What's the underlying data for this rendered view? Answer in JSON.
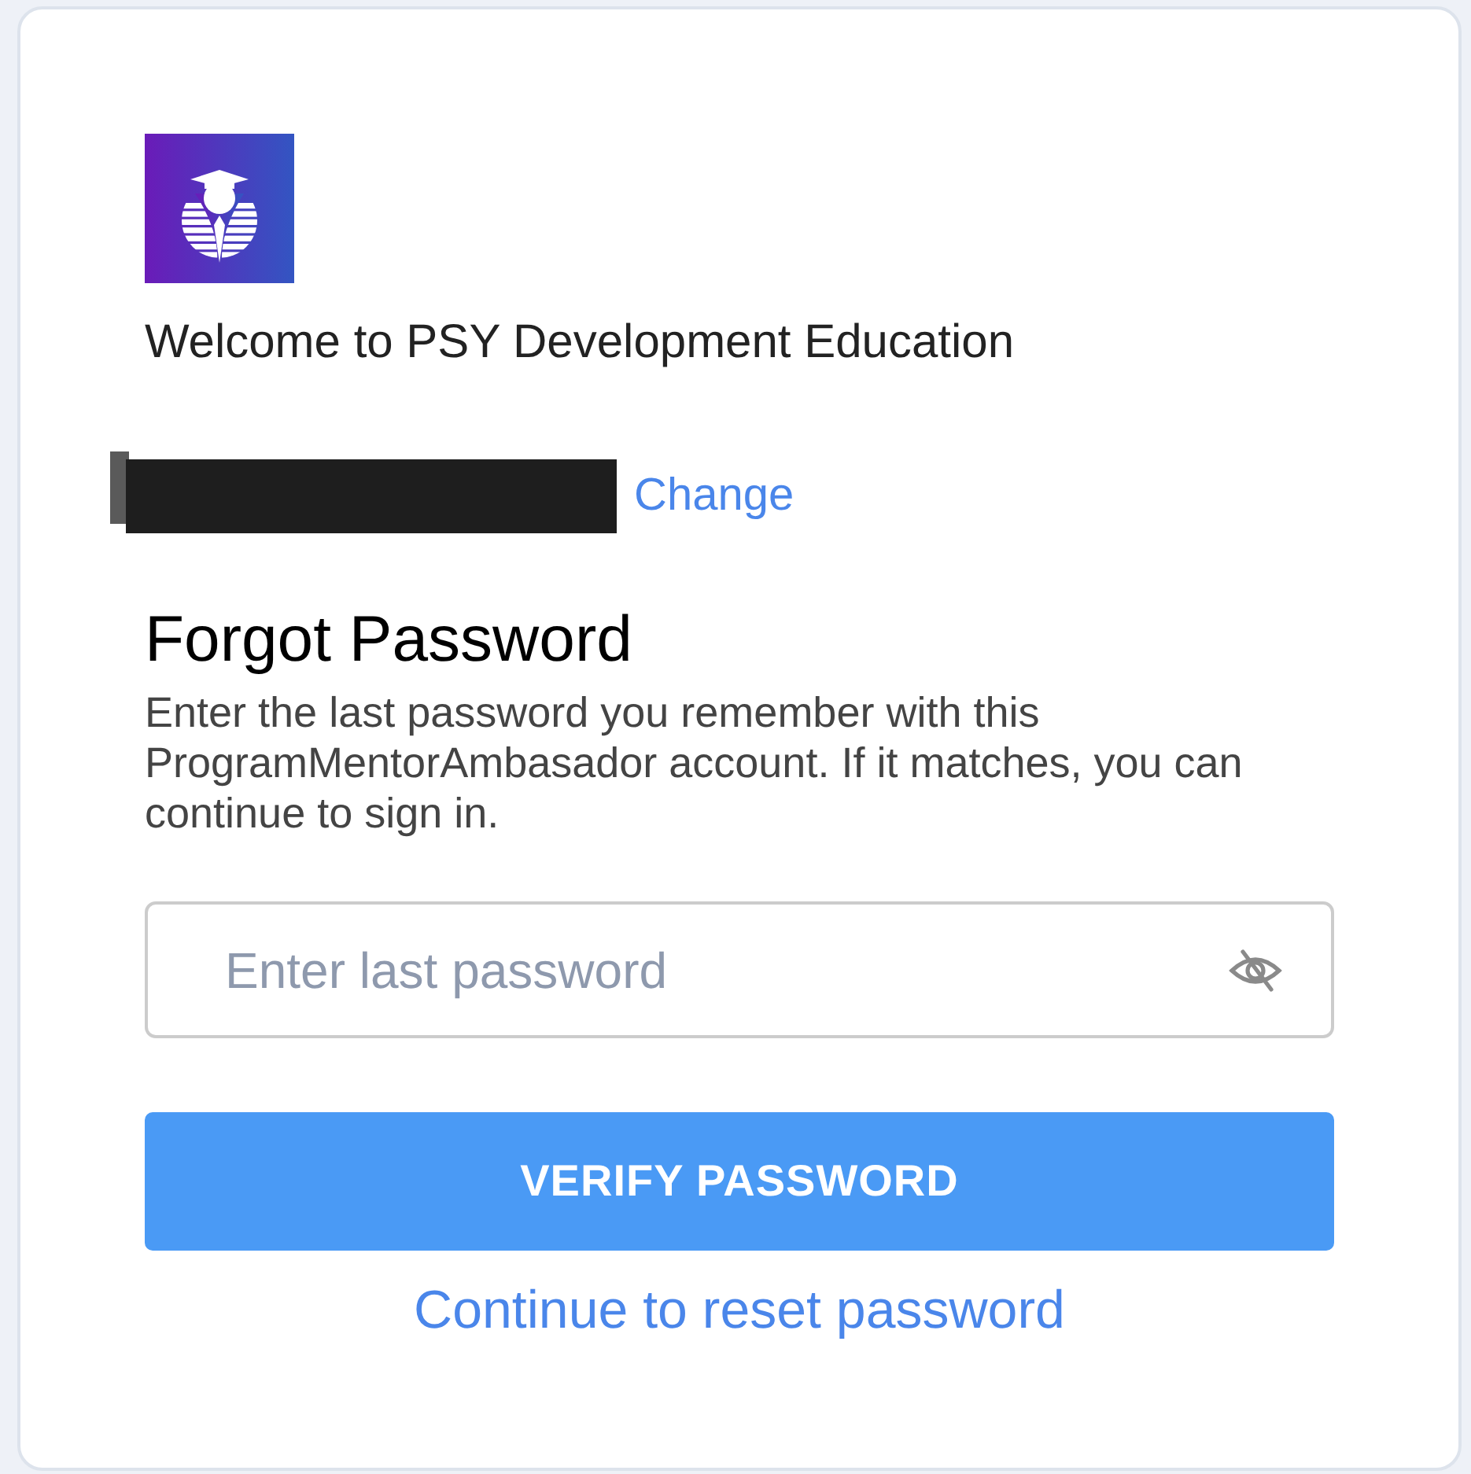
{
  "welcome": "Welcome to PSY Development Education",
  "account": {
    "change_link": "Change"
  },
  "title": "Forgot Password",
  "description": "Enter the last password you remember with this ProgramMentorAmbasador account. If it matches, you can continue to sign in.",
  "password_field": {
    "placeholder": "Enter last password",
    "show_password": false
  },
  "verify_button": "VERIFY PASSWORD",
  "reset_link": "Continue to reset password"
}
